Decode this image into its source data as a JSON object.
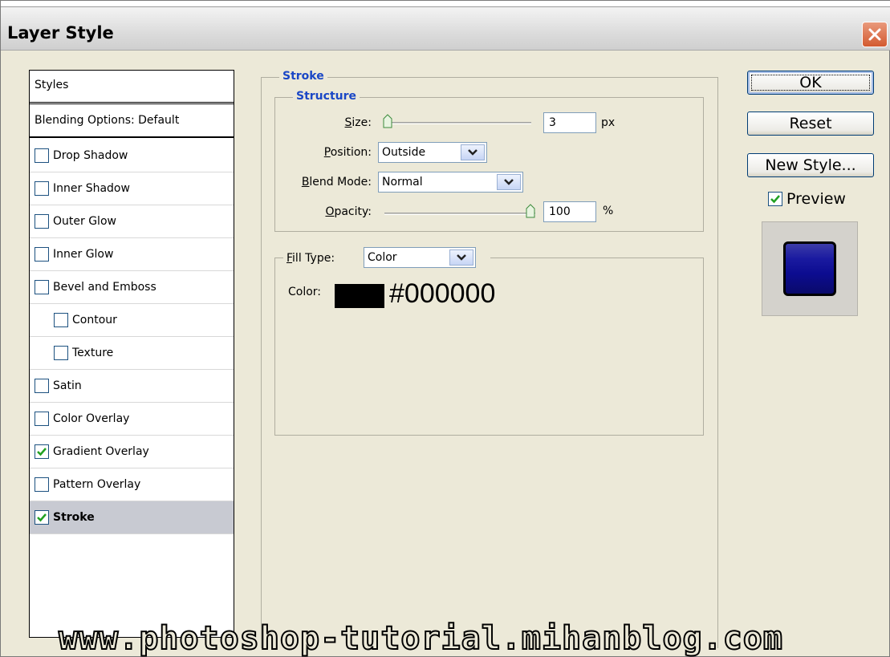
{
  "window": {
    "title": "Layer Style"
  },
  "styles_list": {
    "header": "Styles",
    "blending_options": "Blending Options: Default",
    "items": [
      {
        "label": "Drop Shadow",
        "checked": false,
        "indent": false,
        "selected": false
      },
      {
        "label": "Inner Shadow",
        "checked": false,
        "indent": false,
        "selected": false
      },
      {
        "label": "Outer Glow",
        "checked": false,
        "indent": false,
        "selected": false
      },
      {
        "label": "Inner Glow",
        "checked": false,
        "indent": false,
        "selected": false
      },
      {
        "label": "Bevel and Emboss",
        "checked": false,
        "indent": false,
        "selected": false
      },
      {
        "label": "Contour",
        "checked": false,
        "indent": true,
        "selected": false
      },
      {
        "label": "Texture",
        "checked": false,
        "indent": true,
        "selected": false
      },
      {
        "label": "Satin",
        "checked": false,
        "indent": false,
        "selected": false
      },
      {
        "label": "Color Overlay",
        "checked": false,
        "indent": false,
        "selected": false
      },
      {
        "label": "Gradient Overlay",
        "checked": true,
        "indent": false,
        "selected": false
      },
      {
        "label": "Pattern Overlay",
        "checked": false,
        "indent": false,
        "selected": false
      },
      {
        "label": "Stroke",
        "checked": true,
        "indent": false,
        "selected": true
      }
    ]
  },
  "stroke": {
    "section_title": "Stroke",
    "structure_title": "Structure",
    "size": {
      "label": "Size:",
      "value": "3",
      "unit": "px",
      "slider_fraction": 0.0
    },
    "position": {
      "label": "Position:",
      "value": "Outside"
    },
    "blend_mode": {
      "label": "Blend Mode:",
      "value": "Normal"
    },
    "opacity": {
      "label": "Opacity:",
      "value": "100",
      "unit": "%",
      "slider_fraction": 1.0
    },
    "fill_type": {
      "label": "Fill Type:",
      "value": "Color"
    },
    "color": {
      "label": "Color:",
      "swatch": "#000000",
      "hex_text": "#000000"
    }
  },
  "buttons": {
    "ok": "OK",
    "reset": "Reset",
    "new_style": "New Style...",
    "preview": "Preview",
    "preview_checked": true
  },
  "watermark": "www.photoshop-tutorial.mihanblog.com"
}
